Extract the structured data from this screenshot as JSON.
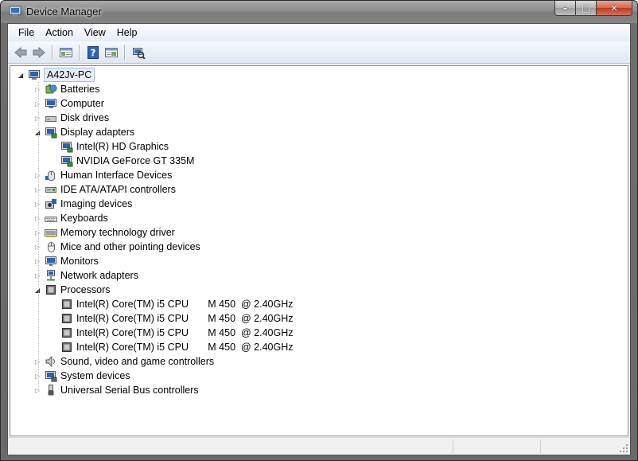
{
  "window": {
    "title": "Device Manager",
    "caption": {
      "minimize": "–",
      "maximize": "□",
      "close": "✕"
    }
  },
  "menu": [
    "File",
    "Action",
    "View",
    "Help"
  ],
  "toolbar": [
    "back-icon",
    "forward-icon",
    "properties-icon",
    "help-icon",
    "show-hidden-icon",
    "scan-hardware-icon"
  ],
  "tree": {
    "root": {
      "label": "A42Jv-PC",
      "icon": "computer-icon",
      "expanded": true
    },
    "categories": [
      {
        "label": "Batteries",
        "icon": "battery-icon",
        "expanded": false,
        "children": []
      },
      {
        "label": "Computer",
        "icon": "computer-icon",
        "expanded": false,
        "children": []
      },
      {
        "label": "Disk drives",
        "icon": "disk-drive-icon",
        "expanded": false,
        "children": []
      },
      {
        "label": "Display adapters",
        "icon": "display-adapter-icon",
        "expanded": true,
        "children": [
          "Intel(R) HD Graphics",
          "NVIDIA GeForce GT 335M"
        ]
      },
      {
        "label": "Human Interface Devices",
        "icon": "hid-icon",
        "expanded": false,
        "children": []
      },
      {
        "label": "IDE ATA/ATAPI controllers",
        "icon": "ide-controller-icon",
        "expanded": false,
        "children": []
      },
      {
        "label": "Imaging devices",
        "icon": "camera-icon",
        "expanded": false,
        "children": []
      },
      {
        "label": "Keyboards",
        "icon": "keyboard-icon",
        "expanded": false,
        "children": []
      },
      {
        "label": "Memory technology driver",
        "icon": "memory-icon",
        "expanded": false,
        "children": []
      },
      {
        "label": "Mice and other pointing devices",
        "icon": "mouse-icon",
        "expanded": false,
        "children": []
      },
      {
        "label": "Monitors",
        "icon": "monitor-icon",
        "expanded": false,
        "children": []
      },
      {
        "label": "Network adapters",
        "icon": "network-icon",
        "expanded": false,
        "children": []
      },
      {
        "label": "Processors",
        "icon": "processor-icon",
        "expanded": true,
        "children": [
          "Intel(R) Core(TM) i5 CPU       M 450  @ 2.40GHz",
          "Intel(R) Core(TM) i5 CPU       M 450  @ 2.40GHz",
          "Intel(R) Core(TM) i5 CPU       M 450  @ 2.40GHz",
          "Intel(R) Core(TM) i5 CPU       M 450  @ 2.40GHz"
        ]
      },
      {
        "label": "Sound, video and game controllers",
        "icon": "speaker-icon",
        "expanded": false,
        "children": []
      },
      {
        "label": "System devices",
        "icon": "system-devices-icon",
        "expanded": false,
        "children": []
      },
      {
        "label": "Universal Serial Bus controllers",
        "icon": "usb-icon",
        "expanded": false,
        "children": []
      }
    ]
  },
  "colors": {
    "selection": "#e8eef9",
    "window_frame": "#7a7a7a",
    "close_button": "#c74a30"
  }
}
